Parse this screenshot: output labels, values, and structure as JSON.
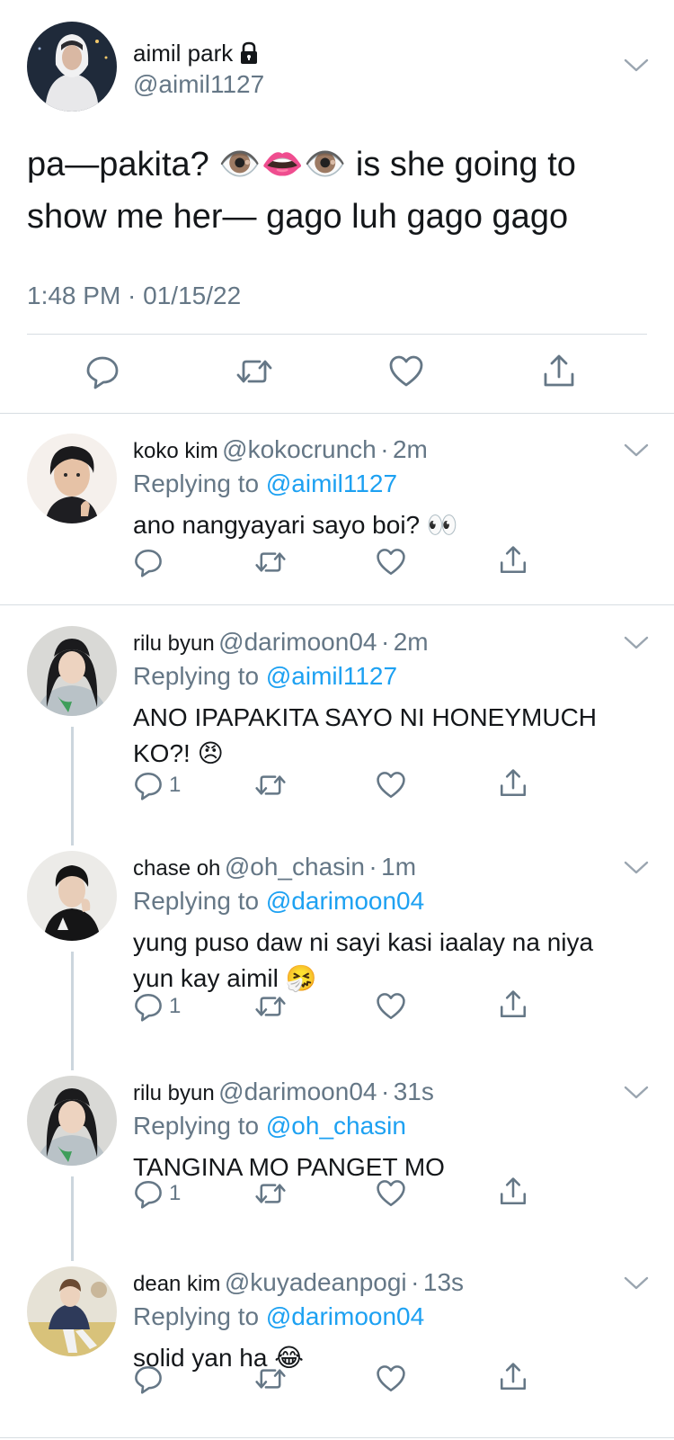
{
  "main_tweet": {
    "name": "aimil park",
    "handle": "@aimil1127",
    "text": "pa—pakita? 👁️👄👁️ is she going to show me her— gago luh gago gago",
    "timestamp": "1:48 PM · 01/15/22",
    "icons": [
      "lock-icon",
      "chevron-down-icon",
      "reply-icon",
      "retweet-icon",
      "like-icon",
      "share-icon"
    ]
  },
  "replies": [
    {
      "name": "koko kim",
      "handle": "@kokocrunch",
      "separator": "·",
      "time": "2m",
      "replying_label": "Replying to",
      "replying_to": "@aimil1127",
      "text": "ano nangyayari sayo boi? 👀",
      "reply_count": ""
    },
    {
      "name": "rilu byun",
      "handle": "@darimoon04",
      "separator": "·",
      "time": "2m",
      "replying_label": "Replying to",
      "replying_to": "@aimil1127",
      "text": "ANO IPAPAKITA SAYO NI HONEYMUCH KO?! 😠",
      "reply_count": "1"
    },
    {
      "name": "chase oh",
      "handle": "@oh_chasin",
      "separator": "·",
      "time": "1m",
      "replying_label": "Replying to",
      "replying_to": "@darimoon04",
      "text": "yung puso daw ni sayi kasi iaalay na niya yun kay aimil 🤧",
      "reply_count": "1"
    },
    {
      "name": "rilu byun",
      "handle": "@darimoon04",
      "separator": "·",
      "time": "31s",
      "replying_label": "Replying to",
      "replying_to": "@oh_chasin",
      "text": "TANGINA MO PANGET MO",
      "reply_count": "1"
    },
    {
      "name": "dean kim",
      "handle": "@kuyadeanpogi",
      "separator": "·",
      "time": "13s",
      "replying_label": "Replying to",
      "replying_to": "@darimoon04",
      "text": "solid yan ha 😂",
      "reply_count": ""
    }
  ],
  "colors": {
    "text": "#14171a",
    "secondary": "#657786",
    "link": "#1da1f2",
    "divider": "#d7dde2",
    "thread_line": "#ccd6dd"
  }
}
